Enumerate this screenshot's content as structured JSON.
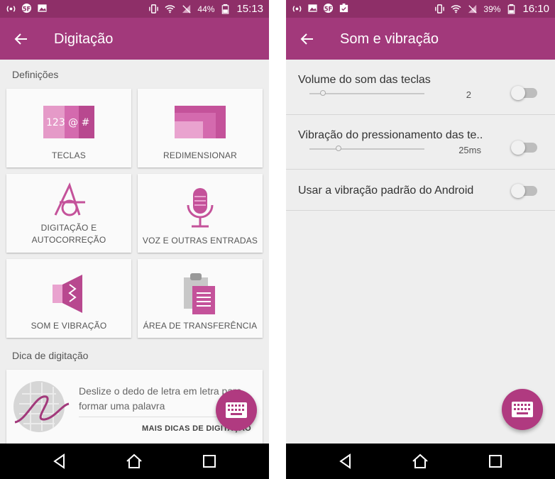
{
  "left": {
    "status": {
      "battery": "44%",
      "time": "15:13"
    },
    "title": "Digitação",
    "definitions_label": "Definições",
    "tiles": [
      {
        "label": "TECLAS",
        "icon": "keys-icon"
      },
      {
        "label": "REDIMENSIONAR",
        "icon": "resize-icon"
      },
      {
        "label_line1": "DIGITAÇÃO E",
        "label_line2": "AUTOCORREÇÃO",
        "icon": "typing-autocorrect-icon"
      },
      {
        "label": "VOZ E OUTRAS ENTRADAS",
        "icon": "microphone-icon"
      },
      {
        "label": "SOM E VIBRAÇÃO",
        "icon": "speaker-icon"
      },
      {
        "label": "ÁREA DE TRANSFERÊNCIA",
        "icon": "clipboard-icon"
      }
    ],
    "tip_label": "Dica de digitação",
    "tip": {
      "text": "Deslize o dedo de letra em letra para formar uma palavra",
      "link": "MAIS DICAS DE DIGITAÇÃO"
    },
    "keys_icon_text": "123 @ #"
  },
  "right": {
    "status": {
      "battery": "39%",
      "time": "16:10"
    },
    "title": "Som e vibração",
    "settings": [
      {
        "title": "Volume do som das teclas",
        "value": "2",
        "level": 0.12,
        "enabled": false
      },
      {
        "title": "Vibração do pressionamento das te..",
        "value": "25ms",
        "level": 0.25,
        "enabled": false
      },
      {
        "title": "Usar a vibração padrão do Android",
        "enabled": false
      }
    ]
  },
  "colors": {
    "status_bar": "#8e2f68",
    "app_bar": "#a2397b",
    "accent": "#b03a80",
    "icon_pink": "#c4529a"
  }
}
